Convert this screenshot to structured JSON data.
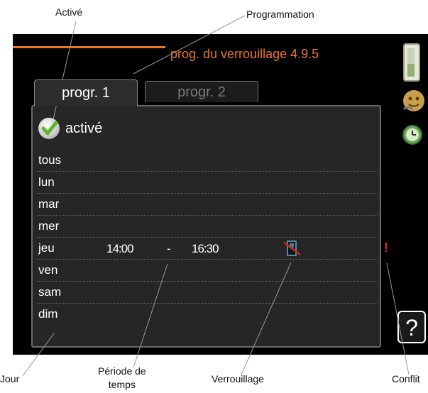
{
  "callouts": {
    "active": "Activé",
    "schedule": "Programmation",
    "day": "Jour",
    "period_line1": "Période de",
    "period_line2": "temps",
    "lock": "Verrouillage",
    "conflict": "Conflit"
  },
  "screen": {
    "title": "prog. du verrouillage 4.9.5",
    "accent_color": "#e8762a",
    "tabs": [
      {
        "label": "progr. 1",
        "active": true
      },
      {
        "label": "progr. 2",
        "active": false
      }
    ],
    "active_checkbox": {
      "label": "activé",
      "checked": true,
      "icon": "checkmark-icon"
    },
    "days": [
      {
        "label": "tous"
      },
      {
        "label": "lun"
      },
      {
        "label": "mar"
      },
      {
        "label": "mer"
      },
      {
        "label": "jeu",
        "start": "14:00",
        "separator": "-",
        "end": "16:30",
        "lock_icon": "lock-blocked-icon",
        "conflict": "!"
      },
      {
        "label": "ven"
      },
      {
        "label": "sam"
      },
      {
        "label": "dim"
      }
    ],
    "side_icons": [
      "thermometer-icon",
      "face-icon",
      "clock-icon"
    ],
    "help_label": "?"
  }
}
